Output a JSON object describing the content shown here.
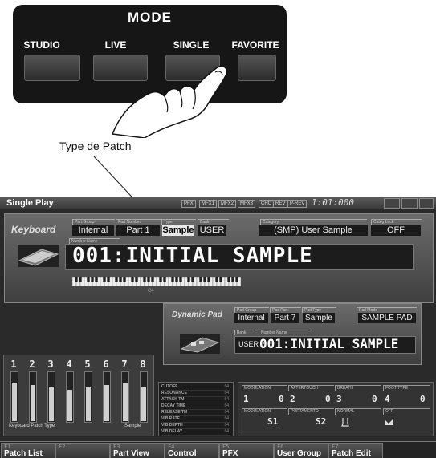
{
  "mode_panel": {
    "title": "MODE",
    "buttons": [
      {
        "label": "STUDIO"
      },
      {
        "label": "LIVE"
      },
      {
        "label": "SINGLE"
      },
      {
        "label": "FAVORITE"
      }
    ]
  },
  "annotation": {
    "label": "Type de Patch"
  },
  "screen": {
    "title": "Single Play",
    "top_chips": [
      "PFX",
      "MFX1",
      "MFX2",
      "MFX3",
      "CHO",
      "REV",
      "P-REV"
    ],
    "clock": "1:01:000",
    "keyboard": {
      "section_label": "Keyboard",
      "headers": {
        "part_group": "Part Group",
        "part_number": "Part Number",
        "type": "Type",
        "bank": "Bank",
        "category": "Category",
        "categ_lock": "Categ Lock",
        "number_name": "Number Name"
      },
      "part_group": "Internal",
      "part_number": "Part 1",
      "type": "Sample",
      "bank": "USER",
      "category": "(SMP) User Sample",
      "categ_lock": "OFF",
      "patch_name": "001:INITIAL SAMPLE",
      "key_label": "C4"
    },
    "pad": {
      "section_label": "Dynamic Pad",
      "headers": {
        "pad_group": "Pad Group",
        "pad_part": "Pad Part",
        "pad_type": "Pad Type",
        "pad_mode": "Pad Mode",
        "bank": "Bank",
        "number_name": "Number Name"
      },
      "pad_group": "Internal",
      "pad_part": "Part 7",
      "pad_type": "Sample",
      "pad_mode": "SAMPLE PAD",
      "bank": "USER",
      "patch_name": "001:INITIAL SAMPLE"
    },
    "parts": {
      "numbers": [
        "1",
        "2",
        "3",
        "4",
        "5",
        "6",
        "7",
        "8"
      ],
      "levels": [
        0.8,
        0.75,
        0.7,
        0.65,
        0.7,
        0.75,
        0.8,
        0.7
      ],
      "patch_type_label": "Keyboard Patch Type",
      "sample_label": "Sample"
    },
    "controls": [
      {
        "name": "CUTOFF",
        "value": "64"
      },
      {
        "name": "RESONANCE",
        "value": "64"
      },
      {
        "name": "ATTACK TM",
        "value": "64"
      },
      {
        "name": "DECAY TIME",
        "value": "64"
      },
      {
        "name": "RELEASE TM",
        "value": "64"
      },
      {
        "name": "VIB RATE",
        "value": "64"
      },
      {
        "name": "VIB DEPTH",
        "value": "64"
      },
      {
        "name": "VIB DELAY",
        "value": "64"
      }
    ],
    "modulation": {
      "headers": [
        "MODULATION",
        "AFTERTOUCH",
        "BREATH",
        "FOOT TYPE"
      ],
      "values": [
        {
          "num": "1",
          "val": "0"
        },
        {
          "num": "2",
          "val": "0"
        },
        {
          "num": "3",
          "val": "0"
        },
        {
          "num": "4",
          "val": "0"
        }
      ],
      "headers2": [
        "MODULATION",
        "PORTAMENTO",
        "NORMAL",
        "OFF"
      ],
      "s1": "S1",
      "s2": "S2"
    },
    "function_keys": [
      {
        "num": "F1",
        "label": "Patch List"
      },
      {
        "num": "F2",
        "label": ""
      },
      {
        "num": "F3",
        "label": "Part View"
      },
      {
        "num": "F4",
        "label": "Control"
      },
      {
        "num": "F5",
        "label": "PFX"
      },
      {
        "num": "F6",
        "label": "User Group"
      },
      {
        "num": "F7",
        "label": "Patch Edit"
      }
    ]
  }
}
